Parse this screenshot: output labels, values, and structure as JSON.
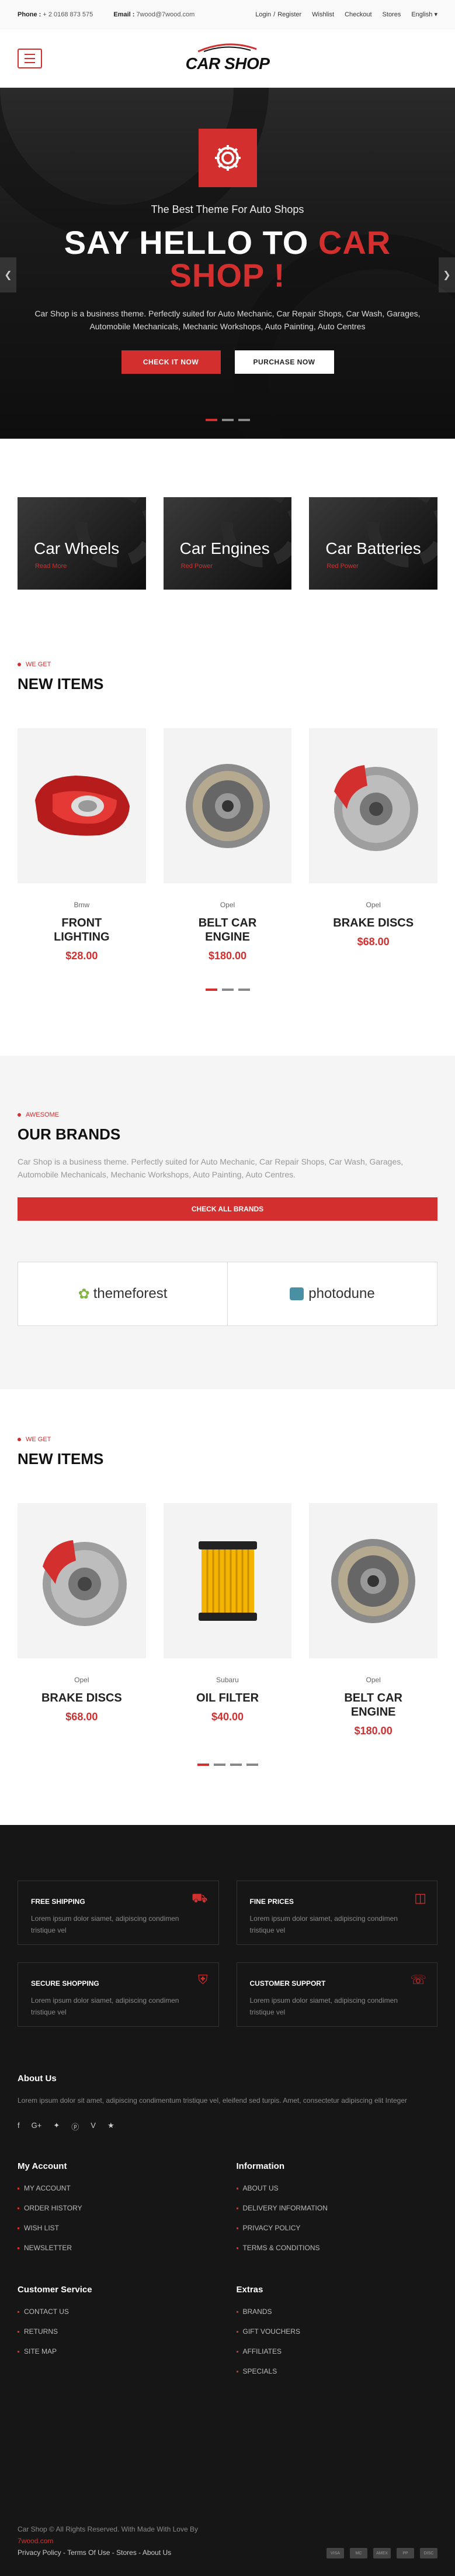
{
  "topbar": {
    "phone_label": "Phone :",
    "phone": "+ 2 0168 873 575",
    "email_label": "Email :",
    "email": "7wood@7wood.com",
    "links": [
      "Login",
      "/",
      "Register",
      "Wishlist",
      "Checkout",
      "Stores",
      "English ▾"
    ]
  },
  "header": {
    "logo": "CAR SHOP"
  },
  "hero": {
    "sub": "The Best Theme For Auto Shops",
    "title_white": "SAY HELLO TO ",
    "title_red_1": "CAR",
    "title_red_2": "SHOP !",
    "desc": "Car Shop is a business theme. Perfectly suited for Auto Mechanic, Car Repair Shops, Car Wash, Garages, Automobile Mechanicals, Mechanic Workshops, Auto Painting, Auto Centres",
    "btn_primary": "CHECK IT NOW",
    "btn_secondary": "PURCHASE NOW"
  },
  "categories": [
    {
      "title": "Car Wheels",
      "link": "Read More"
    },
    {
      "title": "Car Engines",
      "link": "Red Power"
    },
    {
      "title": "Car Batteries",
      "link": "Red Power"
    }
  ],
  "new_items_1": {
    "kicker": "WE GET",
    "title": "NEW ITEMS",
    "items": [
      {
        "brand": "Bmw",
        "name_1": "FRONT",
        "name_2": "LIGHTING",
        "price": "$28.00",
        "icon": "headlight-icon"
      },
      {
        "brand": "Opel",
        "name_1": "BELT CAR",
        "name_2": "ENGINE",
        "price": "$180.00",
        "icon": "clutch-icon"
      },
      {
        "brand": "Opel",
        "name_1": "BRAKE DISCS",
        "name_2": "",
        "price": "$68.00",
        "icon": "brake-disc-icon"
      }
    ]
  },
  "brands": {
    "kicker": "AWESOME",
    "title": "OUR BRANDS",
    "desc": "Car Shop is a business theme. Perfectly suited for Auto Mechanic, Car Repair Shops, Car Wash, Garages, Automobile Mechanicals, Mechanic Workshops, Auto Painting, Auto Centres.",
    "button": "CHECK ALL BRANDS",
    "logos": [
      "themeforest",
      "photodune"
    ]
  },
  "new_items_2": {
    "kicker": "WE GET",
    "title": "NEW ITEMS",
    "items": [
      {
        "brand": "Opel",
        "name_1": "BRAKE DISCS",
        "name_2": "",
        "price": "$68.00",
        "icon": "brake-disc-icon"
      },
      {
        "brand": "Subaru",
        "name_1": "OIL FILTER",
        "name_2": "",
        "price": "$40.00",
        "icon": "oil-filter-icon"
      },
      {
        "brand": "Opel",
        "name_1": "BELT CAR",
        "name_2": "ENGINE",
        "price": "$180.00",
        "icon": "clutch-icon"
      }
    ]
  },
  "features": [
    {
      "title": "FREE SHIPPING",
      "text": "Lorem ipsum dolor siamet, adipiscing condimen tristique vel",
      "icon": "truck-icon"
    },
    {
      "title": "FINE PRICES",
      "text": "Lorem ipsum dolor siamet, adipiscing condimen tristique vel",
      "icon": "money-icon"
    },
    {
      "title": "SECURE SHOPPING",
      "text": "Lorem ipsum dolor siamet, adipiscing condimen tristique vel",
      "icon": "shield-icon"
    },
    {
      "title": "CUSTOMER SUPPORT",
      "text": "Lorem ipsum dolor siamet, adipiscing condimen tristique vel",
      "icon": "headset-icon"
    }
  ],
  "about": {
    "title": "About Us",
    "text": "Lorem ipsum dolor sit amet, adipiscing condimentum tristique vel, eleifend sed turpis. Amet, consectetur adipiscing elit Integer",
    "social": [
      "f",
      "G+",
      "✦",
      "ⓟ",
      "V",
      "★"
    ]
  },
  "footer_cols": {
    "my_account": {
      "title": "My Account",
      "items": [
        "MY ACCOUNT",
        "ORDER HISTORY",
        "WISH LIST",
        "NEWSLETTER"
      ]
    },
    "information": {
      "title": "Information",
      "items": [
        "ABOUT US",
        "DELIVERY INFORMATION",
        "PRIVACY POLICY",
        "TERMS & CONDITIONS"
      ]
    },
    "customer_service": {
      "title": "Customer Service",
      "items": [
        "CONTACT US",
        "RETURNS",
        "SITE MAP"
      ]
    },
    "extras": {
      "title": "Extras",
      "items": [
        "BRANDS",
        "GIFT VOUCHERS",
        "AFFILIATES",
        "SPECIALS"
      ]
    }
  },
  "bottom": {
    "copy": "Car Shop © All Rights Reserved. With Made With Love By",
    "author": "7wood.com",
    "links": "Privacy Policy - Terms Of Use - Stores - About Us",
    "payments": [
      "VISA",
      "MC",
      "AMEX",
      "PP",
      "DISC"
    ]
  },
  "colors": {
    "accent": "#d32f2f",
    "dark": "#161616"
  }
}
